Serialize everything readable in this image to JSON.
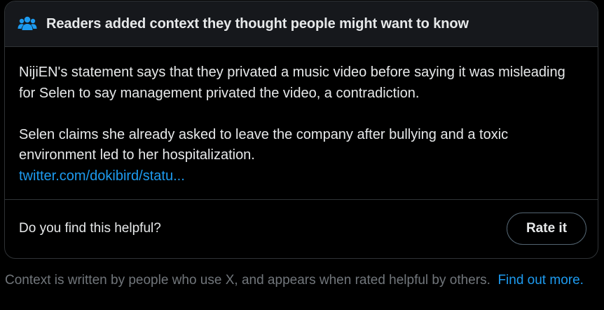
{
  "header": {
    "icon": "people-icon",
    "title": "Readers added context they thought people might want to know",
    "icon_color": "#1d9bf0"
  },
  "note": {
    "paragraph1": "NijiEN's statement says that they privated a music video before saying it was misleading for Selen to say management privated the video, a contradiction.",
    "paragraph2": "Selen claims she already asked to leave the company after bullying and a toxic environment led to her hospitalization.",
    "link": "twitter.com/dokibird/statu..."
  },
  "footer": {
    "question": "Do you find this helpful?",
    "rate_label": "Rate it"
  },
  "disclaimer": {
    "text": "Context is written by people who use X, and appears when rated helpful by others.",
    "link": "Find out more."
  },
  "colors": {
    "link": "#1d9bf0",
    "background": "#000000",
    "header_background": "#16181c",
    "border": "#2f3336",
    "muted_text": "#71767b"
  }
}
